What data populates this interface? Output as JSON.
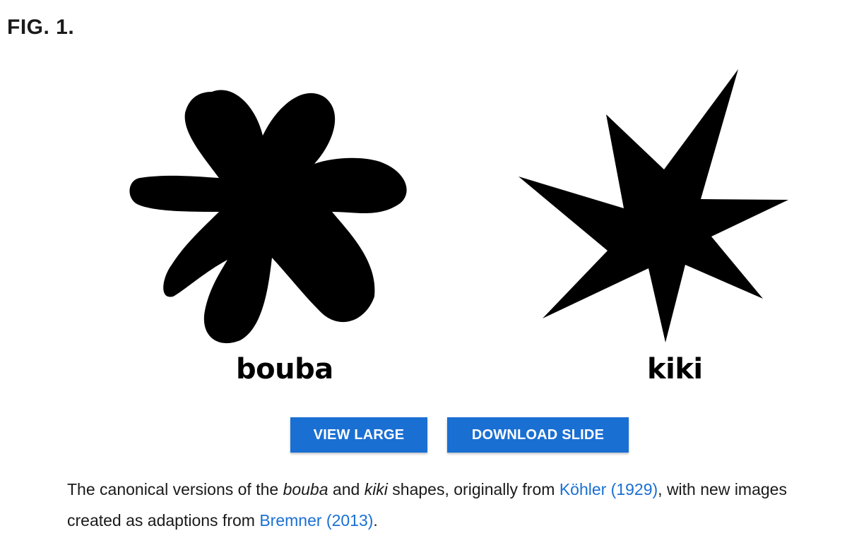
{
  "figure": {
    "label": "FIG. 1.",
    "shapes": {
      "left_label": "bouba",
      "right_label": "kiki"
    }
  },
  "actions": {
    "view_large": "VIEW LARGE",
    "download_slide": "DOWNLOAD SLIDE"
  },
  "caption": {
    "part1": "The canonical versions of the ",
    "em1": "bouba",
    "part2": " and ",
    "em2": "kiki",
    "part3": " shapes, originally from ",
    "link1": "Köhler (1929)",
    "part4": ", with new images created as adaptions from ",
    "link2": "Bremner (2013)",
    "part5": "."
  },
  "colors": {
    "accent": "#1a6fd3",
    "shape_fill": "#000000"
  }
}
